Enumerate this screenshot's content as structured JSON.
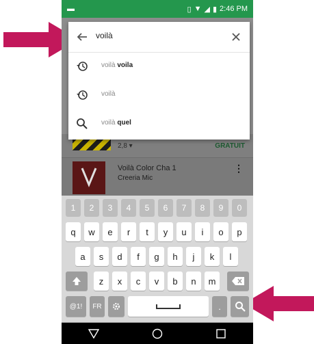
{
  "status": {
    "time": "2:46 PM",
    "left_icon": "notification-icon"
  },
  "search": {
    "query": "voilà"
  },
  "suggestions": [
    {
      "prefix": "voilà ",
      "bold": "voila",
      "icon": "history-icon"
    },
    {
      "prefix": "voilà",
      "bold": "",
      "icon": "history-icon"
    },
    {
      "prefix": "voilà ",
      "bold": "quel",
      "icon": "search-icon"
    }
  ],
  "background": {
    "rating": "2,8 ▾",
    "price": "GRATUIT",
    "app_title": "Voilà Color Cha 1",
    "app_developer": "Creeria Mic",
    "more": "⋮"
  },
  "keyboard": {
    "numbers": [
      "1",
      "2",
      "3",
      "4",
      "5",
      "6",
      "7",
      "8",
      "9",
      "0"
    ],
    "row1": [
      "q",
      "w",
      "e",
      "r",
      "t",
      "y",
      "u",
      "i",
      "o",
      "p"
    ],
    "row2": [
      "a",
      "s",
      "d",
      "f",
      "g",
      "h",
      "j",
      "k",
      "l"
    ],
    "row3": [
      "z",
      "x",
      "c",
      "v",
      "b",
      "n",
      "m"
    ],
    "lang": "FR",
    "sym": "@1!",
    "period": "."
  },
  "colors": {
    "arrow": "#c2185b",
    "statusbar": "#24974d"
  }
}
